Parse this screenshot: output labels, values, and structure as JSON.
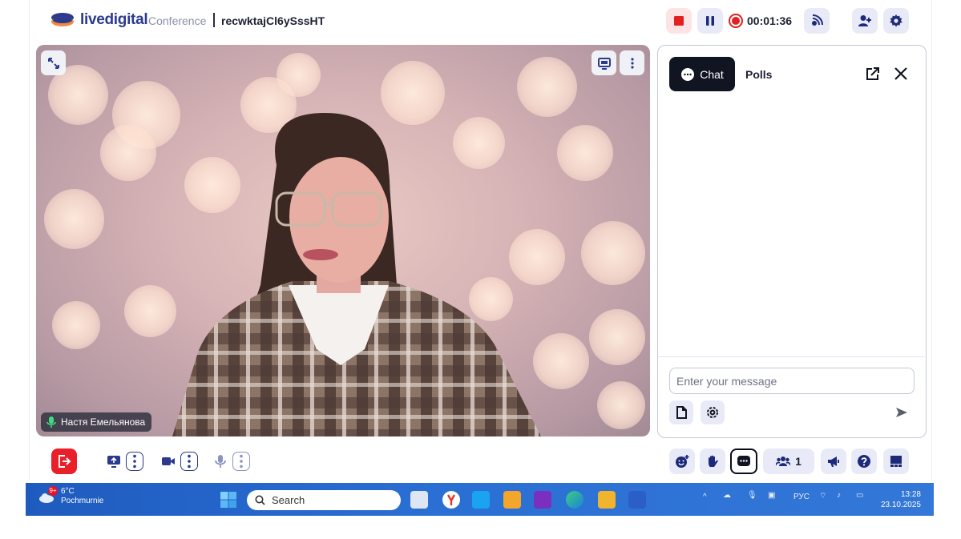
{
  "header": {
    "brand": "livedigital",
    "brand_sub": "Conference",
    "room_id": "recwktajCl6ySssHT",
    "timer": "00:01:36",
    "icons": [
      "stop-recording-icon",
      "pause-icon",
      "broadcast-icon",
      "add-user-icon",
      "gear-icon"
    ]
  },
  "video": {
    "participant_name": "Настя Емельянова",
    "icons": [
      "expand-icon",
      "screen-icon",
      "more-icon",
      "microphone-icon"
    ]
  },
  "chat": {
    "tab_chat": "Chat",
    "tab_polls": "Polls",
    "input_placeholder": "Enter your message",
    "icons": [
      "chat-bubble-icon",
      "open-external-icon",
      "close-icon",
      "file-icon",
      "gear-icon",
      "send-icon"
    ]
  },
  "bottom_bar": {
    "participants_count": "1",
    "icons": [
      "leave-icon",
      "screen-share-icon",
      "camera-icon",
      "microphone-icon",
      "emoji-icon",
      "raise-hand-icon",
      "chat-icon",
      "participants-icon",
      "announce-icon",
      "help-icon",
      "layout-icon"
    ]
  },
  "taskbar": {
    "weather_temp": "6°C",
    "weather_desc": "Pochmurnie",
    "weather_badge": "9+",
    "search_label": "Search",
    "lang": "РУС",
    "time": "13:28",
    "date": "23.10.2025"
  },
  "colors": {
    "brand": "#2b3a8f",
    "danger": "#e9202a",
    "button_bg": "#e8ebf7",
    "dark": "#111521"
  }
}
